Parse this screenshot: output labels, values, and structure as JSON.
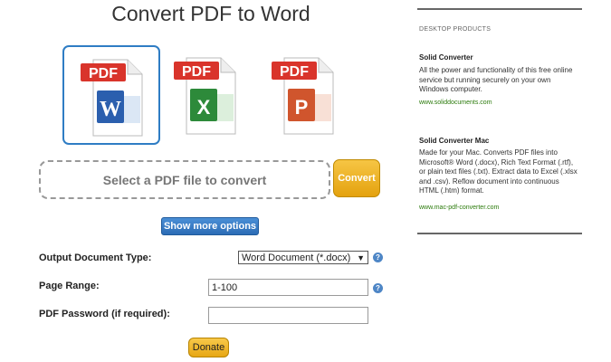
{
  "title": "Convert PDF to Word",
  "formats": [
    {
      "pdf_label": "PDF",
      "letter": "W",
      "color": "#2b5fae",
      "selected": true
    },
    {
      "pdf_label": "PDF",
      "letter": "X",
      "color": "#2d8a3a",
      "selected": false
    },
    {
      "pdf_label": "PDF",
      "letter": "P",
      "color": "#d0552d",
      "selected": false
    }
  ],
  "upload": {
    "dropzone_label": "Select a PDF file to convert",
    "convert_label": "Convert"
  },
  "options": {
    "more_options_label": "Show more options",
    "doc_type_label": "Output Document Type:",
    "doc_type_value": "Word Document (*.docx)",
    "page_range_label": "Page Range:",
    "page_range_value": "1-100",
    "password_label": "PDF Password (if required):",
    "password_value": "",
    "help_glyph": "?"
  },
  "donate_label": "Donate",
  "sidebar": {
    "heading": "DESKTOP PRODUCTS",
    "products": [
      {
        "name": "Solid Converter",
        "desc": "All the power and functionality of this free online service but running securely on your own Windows computer.",
        "link": "www.soliddocuments.com"
      },
      {
        "name": "Solid Converter Mac",
        "desc": "Made for your Mac. Converts PDF files into Microsoft® Word (.docx), Rich Text Format (.rtf), or plain text files (.txt). Extract data to Excel (.xlsx and .csv). Reflow document into continuous HTML (.htm) format.",
        "link": "www.mac-pdf-converter.com"
      }
    ]
  },
  "colors": {
    "accent": "#2f7dc4",
    "convert": "#e8a81a",
    "link": "#2a7a0a",
    "pdf_red": "#d9342b"
  }
}
